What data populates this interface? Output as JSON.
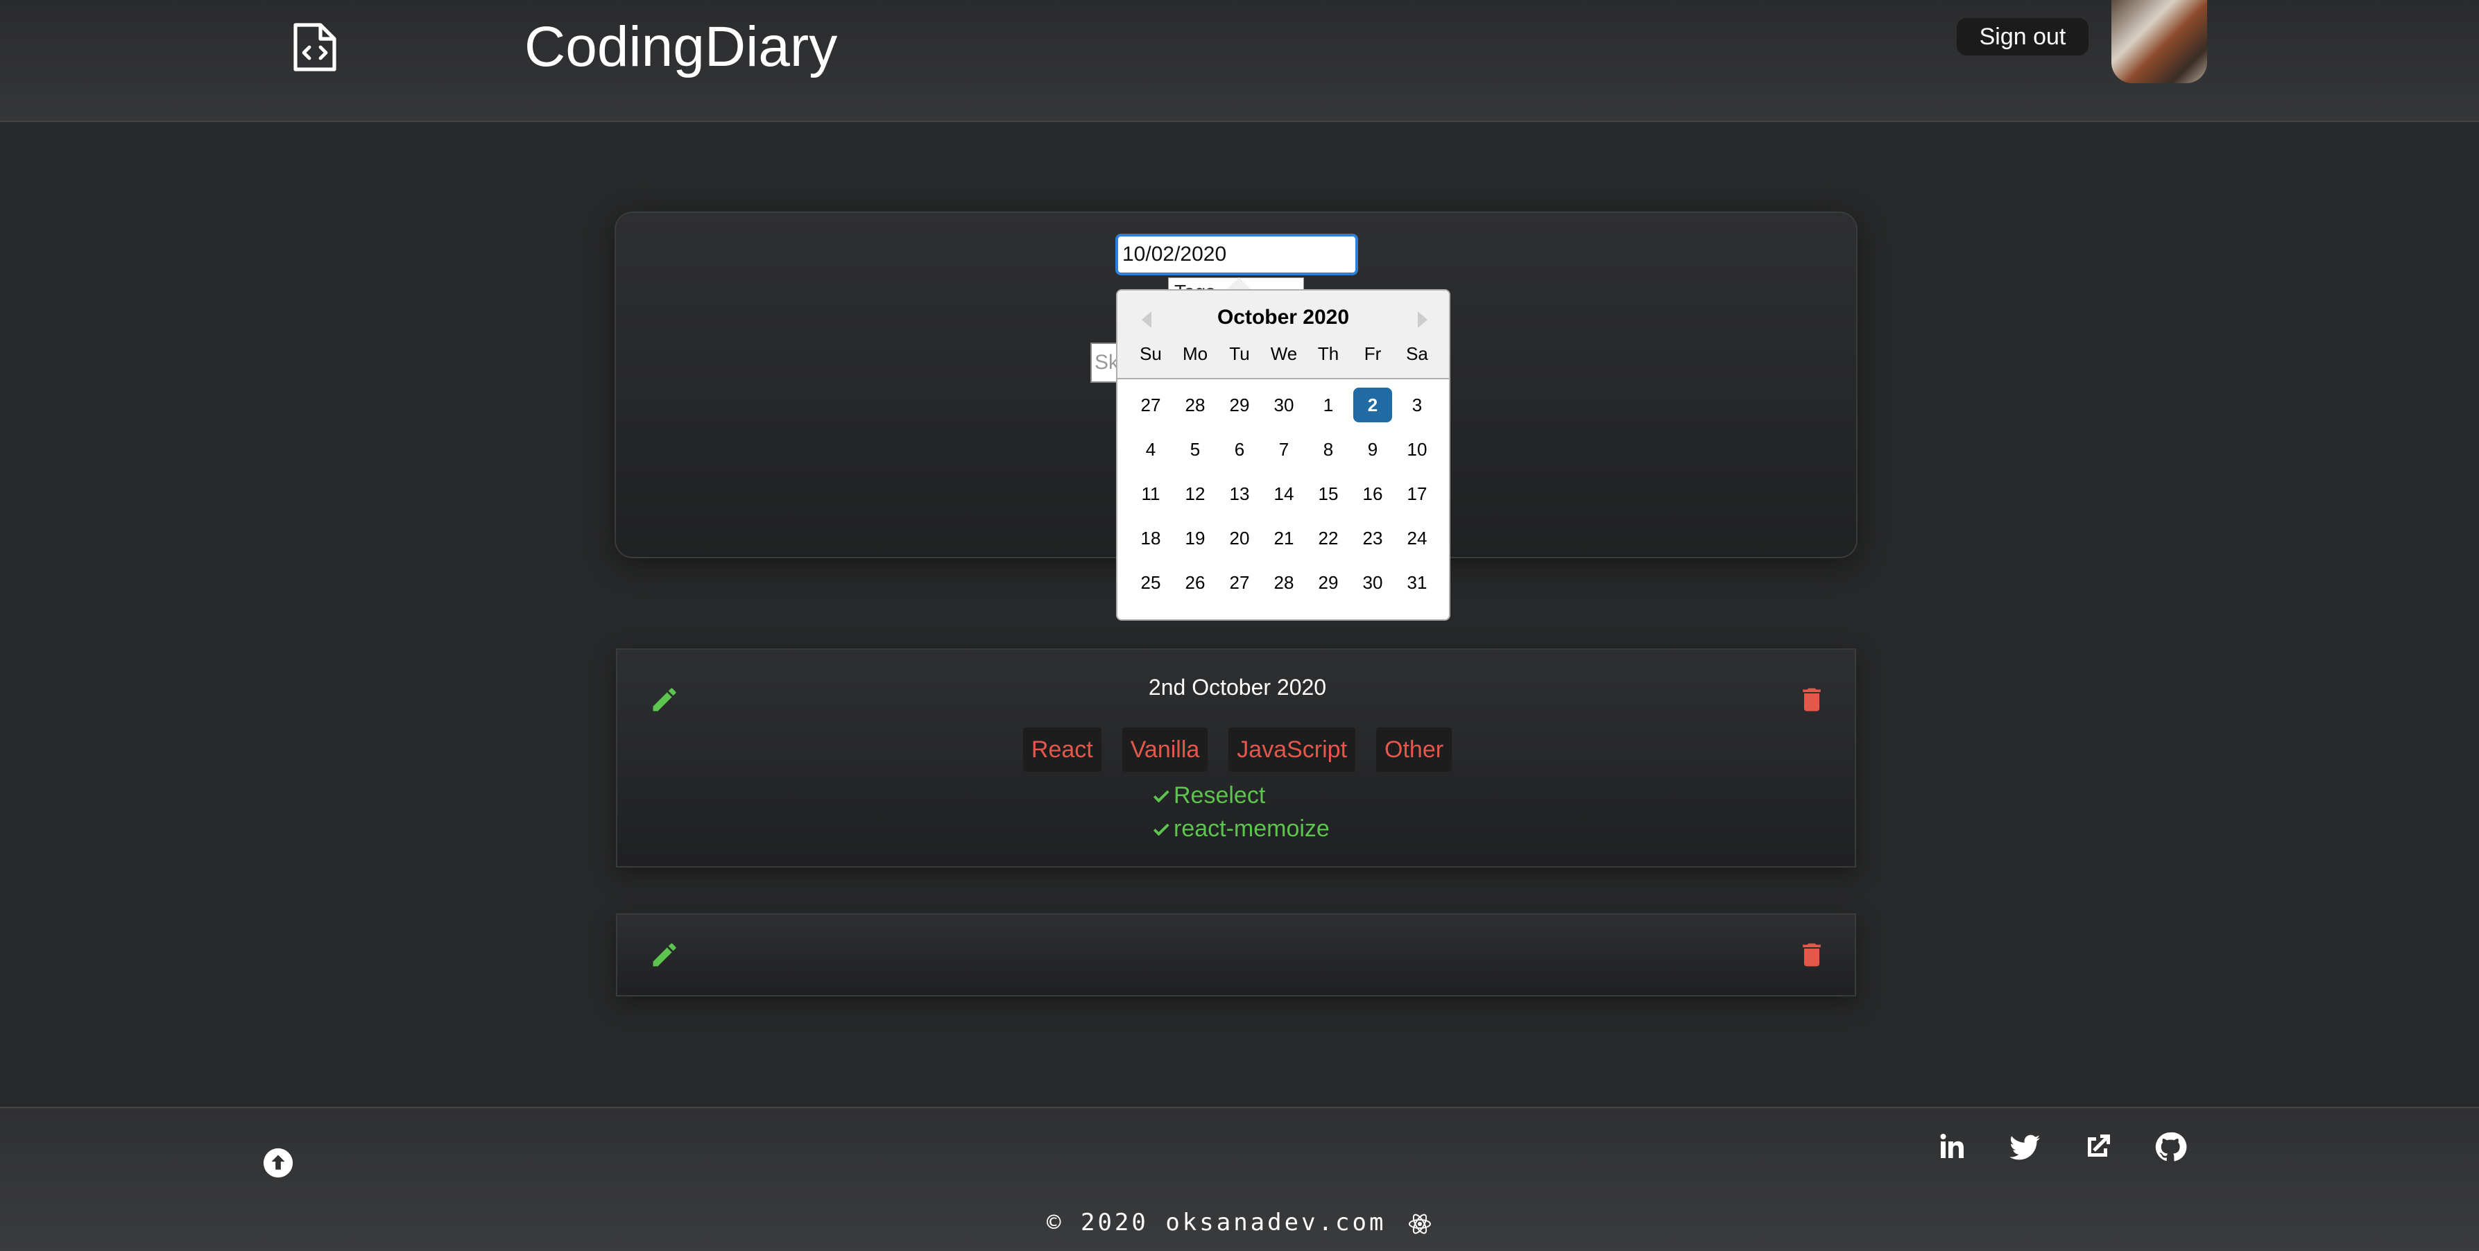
{
  "header": {
    "title": "CodingDiary",
    "sign_out_label": "Sign out"
  },
  "form": {
    "date_value": "10/02/2020",
    "tags_placeholder": "Tags",
    "skill_placeholder": "Sk"
  },
  "datepicker": {
    "month_label": "October 2020",
    "weekdays": [
      "Su",
      "Mo",
      "Tu",
      "We",
      "Th",
      "Fr",
      "Sa"
    ],
    "weeks": [
      [
        "27",
        "28",
        "29",
        "30",
        "1",
        "2",
        "3"
      ],
      [
        "4",
        "5",
        "6",
        "7",
        "8",
        "9",
        "10"
      ],
      [
        "11",
        "12",
        "13",
        "14",
        "15",
        "16",
        "17"
      ],
      [
        "18",
        "19",
        "20",
        "21",
        "22",
        "23",
        "24"
      ],
      [
        "25",
        "26",
        "27",
        "28",
        "29",
        "30",
        "31"
      ]
    ],
    "selected_day": "2"
  },
  "entries": [
    {
      "date": "2nd October 2020",
      "tags": [
        "React",
        "Vanilla",
        "JavaScript",
        "Other"
      ],
      "skills": [
        "Reselect",
        "react-memoize"
      ]
    },
    {
      "date": "",
      "tags": [],
      "skills": []
    }
  ],
  "footer": {
    "copyright": "© 2020 oksanadev.com"
  },
  "colors": {
    "accent_blue": "#216ba5",
    "edit_green": "#5cc44f",
    "delete_red": "#e5574b",
    "background": "#272829"
  },
  "icons": {
    "logo": "code-file-icon",
    "edit": "pencil-icon",
    "delete": "trash-icon",
    "scroll_top": "arrow-up-circle-icon",
    "linkedin": "linkedin-icon",
    "twitter": "twitter-icon",
    "external": "external-link-icon",
    "github": "github-icon",
    "react": "react-icon",
    "check": "check-icon"
  }
}
